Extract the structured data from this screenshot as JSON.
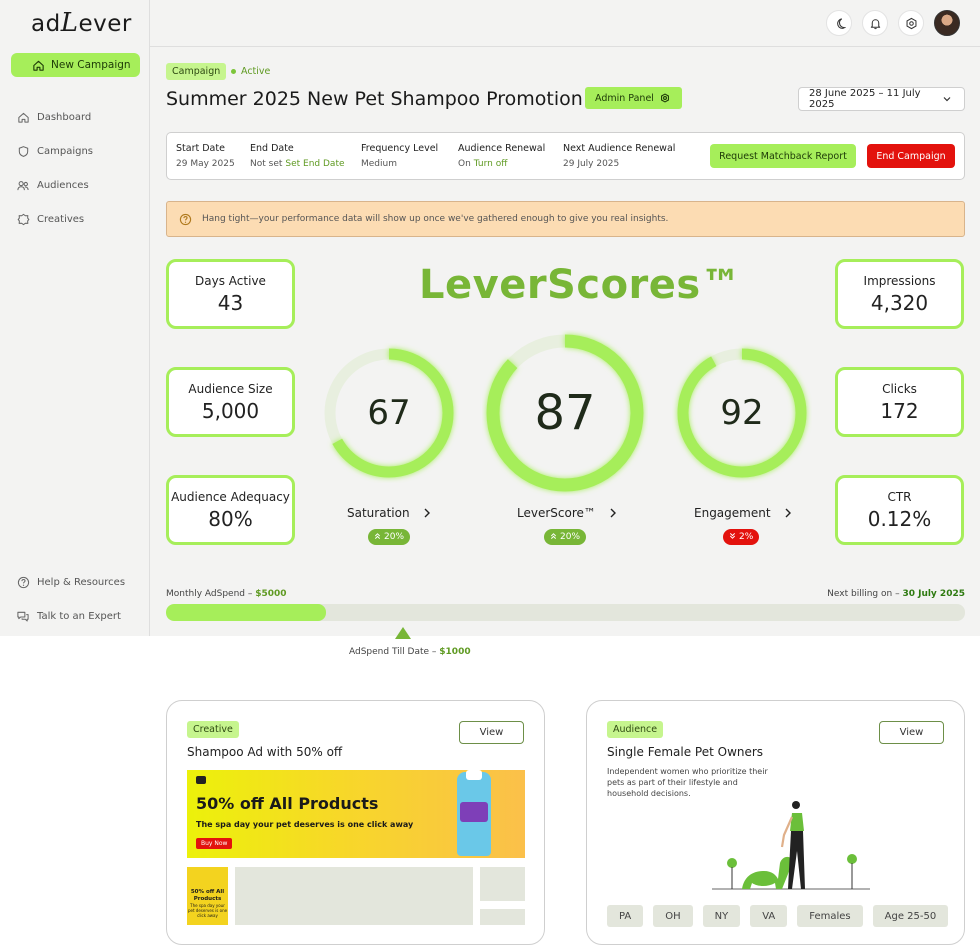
{
  "brand": {
    "logo_prefix": "ad",
    "logo_big": "L",
    "logo_suffix": "ever"
  },
  "sidebar": {
    "new_campaign_label": "New Campaign",
    "items": [
      {
        "label": "Dashboard",
        "icon": "home-icon"
      },
      {
        "label": "Campaigns",
        "icon": "shield-icon"
      },
      {
        "label": "Audiences",
        "icon": "users-icon"
      },
      {
        "label": "Creatives",
        "icon": "creative-icon"
      }
    ],
    "bottom_items": [
      {
        "label": "Help & Resources",
        "icon": "help-icon"
      },
      {
        "label": "Talk to an Expert",
        "icon": "chat-icon"
      }
    ]
  },
  "topbar": {
    "icons": [
      "moon-icon",
      "bell-icon",
      "settings-icon",
      "avatar"
    ]
  },
  "campaign": {
    "tag": "Campaign",
    "status": "Active",
    "title": "Summer 2025 New Pet Shampoo Promotion",
    "admin_label": "Admin Panel",
    "date_range": "28 June 2025  – 11 July 2025"
  },
  "info": {
    "start_label": "Start Date",
    "start_value": "29 May 2025",
    "end_label": "End Date",
    "end_value": "Not set",
    "end_link": "Set End Date",
    "freq_label": "Frequency Level",
    "freq_value": "Medium",
    "renewal_label": "Audience Renewal",
    "renewal_value": "On",
    "renewal_link": "Turn off",
    "next_label": "Next Audience Renewal",
    "next_value": "29 July 2025",
    "report_button": "Request Matchback Report",
    "end_button": "End Campaign"
  },
  "alert": {
    "text": "Hang tight—your performance data will show up once we've gathered enough to give you real insights."
  },
  "stats": {
    "days_label": "Days Active",
    "days_value": "43",
    "audsize_label": "Audience Size",
    "audsize_value": "5,000",
    "adequacy_label": "Audience Adequacy",
    "adequacy_value": "80%",
    "impressions_label": "Impressions",
    "impressions_value": "4,320",
    "clicks_label": "Clicks",
    "clicks_value": "172",
    "ctr_label": "CTR",
    "ctr_value": "0.12%"
  },
  "leverscores": {
    "title": "LeverScores™",
    "gauges": [
      {
        "label": "Saturation",
        "value": 67,
        "change": "20%",
        "direction": "up"
      },
      {
        "label": "LeverScore™",
        "value": 87,
        "change": "20%",
        "direction": "up"
      },
      {
        "label": "Engagement",
        "value": 92,
        "change": "2%",
        "direction": "down"
      }
    ]
  },
  "spend": {
    "monthly_label": "Monthly AdSpend – ",
    "monthly_value": "$5000",
    "billing_label": "Next billing on – ",
    "billing_value": "30 July 2025",
    "till_label": "AdSpend Till Date – ",
    "till_value": "$1000",
    "progress_fraction": 0.2
  },
  "creative_card": {
    "tag": "Creative",
    "title": "Shampoo Ad with 50% off",
    "view": "View",
    "banner_headline": "50% off All Products",
    "banner_sub": "The spa day your pet deserves is one click away",
    "banner_button": "Buy Now",
    "thumb_headline": "50% off All Products",
    "thumb_sub": "The spa day your pet deserves is one click away"
  },
  "audience_card": {
    "tag": "Audience",
    "title": "Single Female Pet Owners",
    "view": "View",
    "description": "Independent women who prioritize their pets as part of their lifestyle and household decisions.",
    "chips": [
      "PA",
      "OH",
      "NY",
      "VA",
      "Females",
      "Age 25-50"
    ]
  },
  "colors": {
    "accent": "#a6ee5a",
    "accent_dark": "#78b637",
    "danger": "#e3120d",
    "alert_bg": "#fcdcb3"
  }
}
